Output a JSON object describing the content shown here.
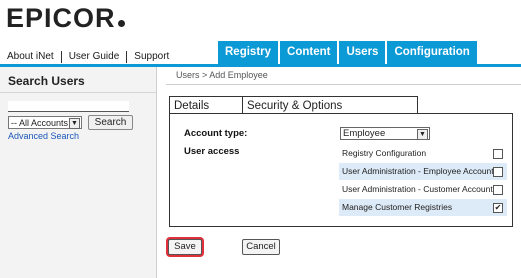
{
  "logo": {
    "text": "EPICOR"
  },
  "top_links": [
    "About iNet",
    "User Guide",
    "Support"
  ],
  "main_tabs": [
    "Registry",
    "Content",
    "Users",
    "Configuration"
  ],
  "sidebar": {
    "title": "Search Users",
    "search_value": "",
    "account_filter": "-- All Accounts --",
    "search_button": "Search",
    "advanced_link": "Advanced Search"
  },
  "breadcrumb": "Users > Add Employee",
  "sub_tabs": [
    "Details",
    "Security & Options"
  ],
  "form": {
    "account_type_label": "Account type:",
    "account_type_value": "Employee",
    "user_access_label": "User access",
    "access_items": [
      {
        "label": "Registry Configuration",
        "checked": false
      },
      {
        "label": "User Administration - Employee Accounts",
        "checked": false
      },
      {
        "label": "User Administration - Customer Accounts",
        "checked": false
      },
      {
        "label": "Manage Customer Registries",
        "checked": true
      }
    ]
  },
  "buttons": {
    "save": "Save",
    "cancel": "Cancel"
  },
  "colors": {
    "tab_blue": "#0c9ad6",
    "row_highlight": "#ddeaf7",
    "save_outline": "#e0303a"
  }
}
